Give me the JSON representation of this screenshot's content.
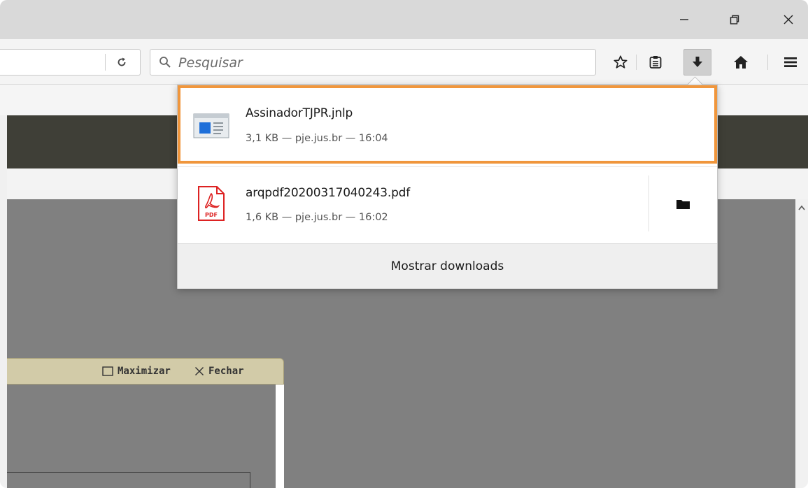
{
  "browser": {
    "window_controls": {
      "minimize_icon": "minimize-icon",
      "restore_icon": "restore-icon",
      "close_icon": "close-icon"
    },
    "search": {
      "placeholder": "Pesquisar"
    },
    "toolbar": {
      "icons": [
        "reload-icon",
        "search-icon",
        "bookmark-star-icon",
        "reading-list-icon",
        "download-icon",
        "home-icon",
        "menu-icon"
      ]
    }
  },
  "downloads_panel": {
    "items": [
      {
        "filename": "AssinadorTJPR.jnlp",
        "meta": "3,1 KB — pje.jus.br — 16:04",
        "icon": "jnlp-file-icon",
        "highlighted": true
      },
      {
        "filename": "arqpdf20200317040243.pdf",
        "meta": "1,6 KB — pje.jus.br — 16:02",
        "icon": "pdf-file-icon",
        "action_icon": "open-folder-icon"
      }
    ],
    "show_all_label": "Mostrar downloads"
  },
  "page": {
    "dialog": {
      "maximize_label": "Maximizar",
      "close_label": "Fechar"
    }
  },
  "colors": {
    "highlight": "#f0963c",
    "header_band": "#3f3f37",
    "content_bg": "#808080",
    "dialog_header": "#d2cba8"
  }
}
